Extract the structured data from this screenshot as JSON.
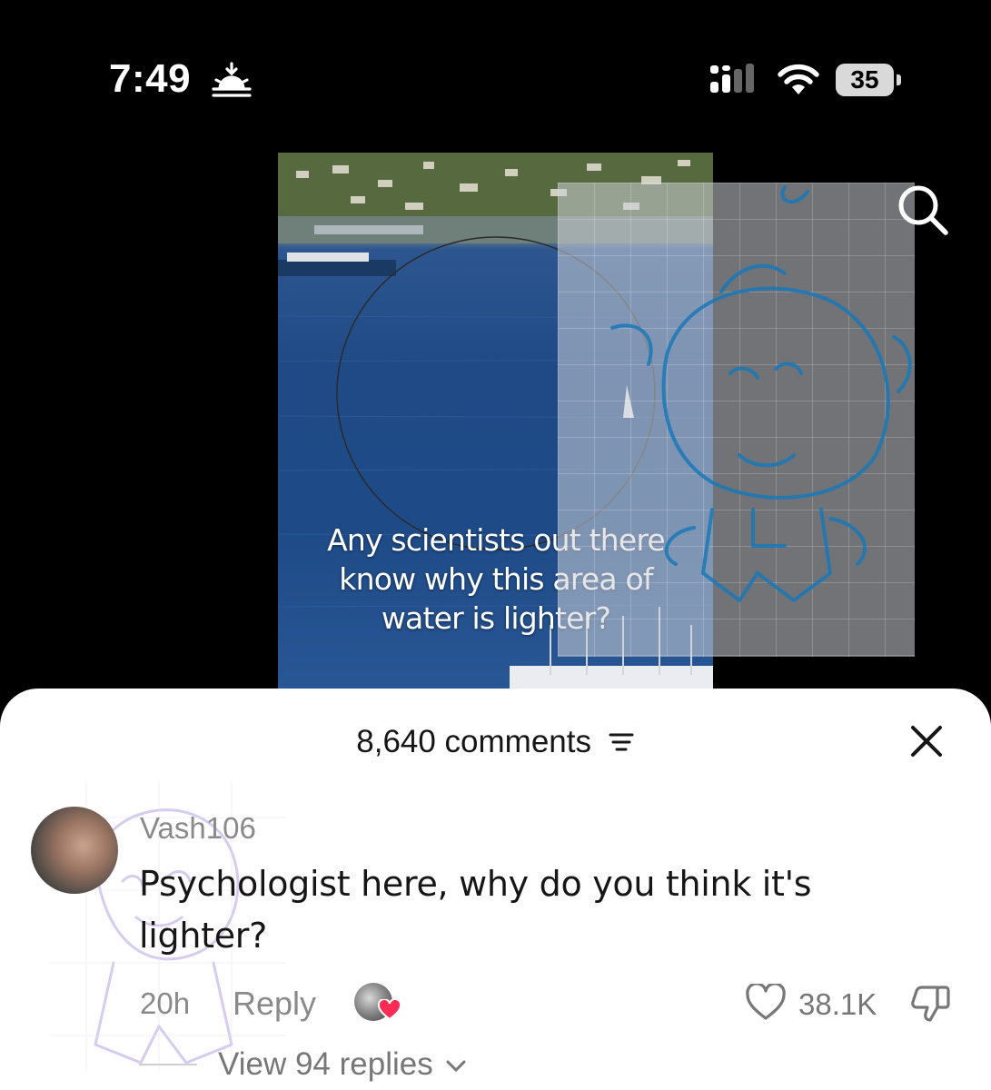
{
  "status_bar": {
    "time": "7:49",
    "battery": "35"
  },
  "video": {
    "caption_lines": [
      "Any scientists out there",
      "know why this area of",
      "water is lighter?"
    ]
  },
  "comments_sheet": {
    "count_label": "8,640 comments",
    "comment": {
      "username": "Vash106",
      "text": "Psychologist here, why do you think it's lighter?",
      "time": "20h",
      "reply_label": "Reply",
      "like_count": "38.1K",
      "view_replies_label": "View 94 replies"
    }
  },
  "colors": {
    "accent_heart": "#fe2c55",
    "sticker_stroke": "#1a78b8",
    "watermark_stroke": "#8b6fd6"
  },
  "icons": [
    "sunrise-icon",
    "signal-icon",
    "wifi-icon",
    "search-icon",
    "sort-icon",
    "close-icon",
    "heart-icon",
    "dislike-icon",
    "chevron-down-icon"
  ]
}
